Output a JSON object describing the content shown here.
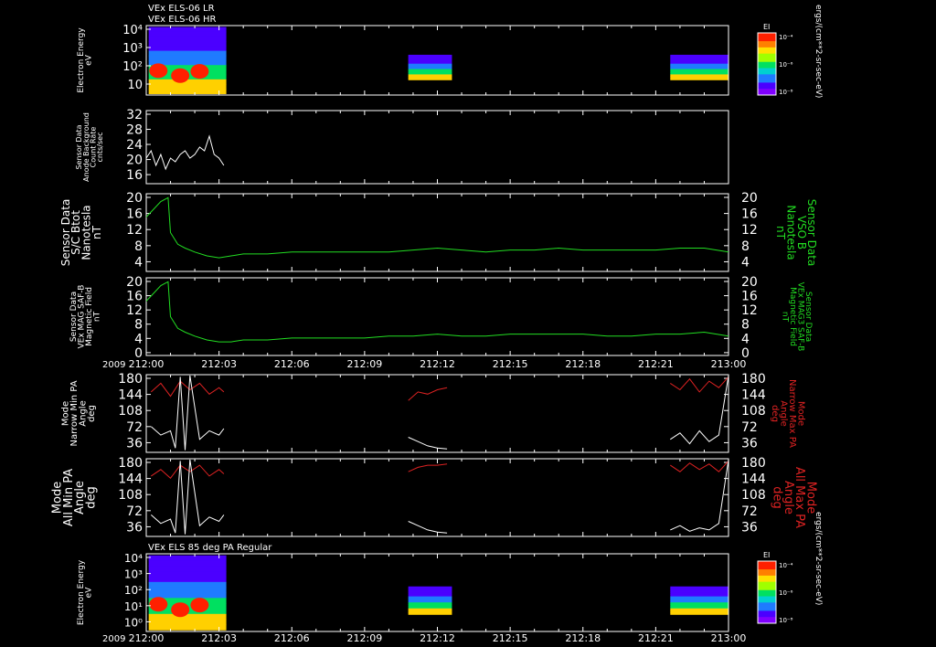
{
  "figure": {
    "top_titles": [
      "VEx ELS-06 LR",
      "VEx ELS-06 HR"
    ],
    "bottom_title": "VEx ELS 85 deg PA Regular",
    "year_label": "2009",
    "time_ticks": [
      "212:00",
      "212:03",
      "212:06",
      "212:09",
      "212:12",
      "212:15",
      "212:18",
      "212:21",
      "213:00"
    ],
    "colorbar_title": "EI",
    "colorbar_unit": "ergs/(cm**2-sr-sec-eV)",
    "colorbar_ticks": [
      "10⁻⁴",
      "10⁻⁶",
      "10⁻⁸"
    ]
  },
  "chart_data": [
    {
      "id": "spec_top",
      "type": "heatmap",
      "ylabel": [
        "Electron Energy",
        "eV"
      ],
      "yscale": "log",
      "ytick_labels": [
        "10⁴",
        "10³",
        "10²",
        "10",
        "1"
      ],
      "data_intervals": [
        "212:00–212:03",
        "212:10:30–212:12:30",
        "212:21:30–213:00"
      ],
      "colors": {
        "low": "#4b00ff",
        "mid": "#00e060",
        "high": "#ff2000"
      }
    },
    {
      "id": "bg_count",
      "type": "line",
      "ylabel": [
        "Sensor Data",
        "Anode Background",
        "Count Rate",
        "cnts/sec"
      ],
      "ylim": [
        12,
        32
      ],
      "ytick_labels": [
        "32",
        "28",
        "24",
        "20",
        "16"
      ],
      "color": "#ffffff",
      "x_minutes": [
        0.0,
        0.2,
        0.4,
        0.6,
        0.8,
        1.0,
        1.2,
        1.4,
        1.6,
        1.8,
        2.0,
        2.2,
        2.4,
        2.6,
        2.8,
        3.0,
        3.2
      ],
      "y": [
        19,
        21,
        17,
        20,
        16,
        19,
        18,
        20,
        21,
        19,
        20,
        22,
        21,
        25,
        20,
        19,
        17
      ]
    },
    {
      "id": "btot",
      "type": "line",
      "ylabel": [
        "Sensor Data",
        "S/C Btot",
        "Nanotesla",
        "nT"
      ],
      "ylabel_right": [
        "Sensor Data",
        "VSO B",
        "Nanotesla",
        "nT"
      ],
      "ylim": [
        0,
        20
      ],
      "ytick_labels": [
        "20",
        "16",
        "12",
        "8",
        "4"
      ],
      "color": "#22dd22",
      "x_minutes": [
        0,
        0.3,
        0.6,
        0.9,
        1.0,
        1.3,
        1.6,
        2.0,
        2.5,
        3.0,
        3.5,
        4.0,
        5.0,
        6.0,
        7.0,
        8.0,
        9.0,
        10.0,
        11.0,
        12.0,
        13.0,
        14.0,
        15.0,
        16.0,
        17.0,
        18.0,
        19.0,
        20.0,
        21.0,
        22.0,
        23.0,
        24.0
      ],
      "y": [
        14,
        16,
        18,
        19,
        10,
        7,
        6,
        5,
        4,
        3.5,
        4,
        4.5,
        4.5,
        5,
        5,
        5,
        5,
        5,
        5.5,
        6,
        5.5,
        5,
        5.5,
        5.5,
        6,
        5.5,
        5.5,
        5.5,
        5.5,
        6,
        6,
        5
      ]
    },
    {
      "id": "mag_field",
      "type": "line",
      "ylabel": [
        "Sensor Data",
        "VEx MAG SAF-B",
        "Magnetic Field",
        "nT"
      ],
      "ylabel_right": [
        "Sensor Data",
        "VEx MAG3 SAF-B",
        "Magnetic Field",
        "nT"
      ],
      "ylim": [
        0,
        20
      ],
      "ytick_labels": [
        "20",
        "16",
        "12",
        "8",
        "4",
        "0"
      ],
      "color": "#22dd22",
      "x_minutes": [
        0,
        0.3,
        0.6,
        0.9,
        1.0,
        1.3,
        1.6,
        2.0,
        2.5,
        3.0,
        3.5,
        4.0,
        5.0,
        6.0,
        7.0,
        8.0,
        9.0,
        10.0,
        11.0,
        12.0,
        13.0,
        14.0,
        15.0,
        16.0,
        17.0,
        18.0,
        19.0,
        20.0,
        21.0,
        22.0,
        23.0,
        24.0
      ],
      "y": [
        14,
        16,
        18,
        19,
        10,
        7,
        6,
        5,
        4,
        3.5,
        3.5,
        4,
        4,
        4.5,
        4.5,
        4.5,
        4.5,
        5,
        5,
        5.5,
        5,
        5,
        5.5,
        5.5,
        5.5,
        5.5,
        5,
        5,
        5.5,
        5.5,
        6,
        5
      ]
    },
    {
      "id": "narrow_pa",
      "type": "line",
      "ylabel": [
        "Mode",
        "Narrow Min PA",
        "Angle",
        "deg"
      ],
      "ylabel_right": [
        "Mode",
        "Narrow Max PA",
        "Angle",
        "deg"
      ],
      "ylim": [
        0,
        180
      ],
      "ytick_labels": [
        "180",
        "144",
        "108",
        "72",
        "36"
      ],
      "series": [
        {
          "color": "#dd2222",
          "segments": [
            {
              "x_minutes": [
                0.2,
                0.6,
                1.0,
                1.4,
                1.8,
                2.2,
                2.6,
                3.0,
                3.2
              ],
              "y": [
                140,
                160,
                130,
                165,
                145,
                160,
                135,
                150,
                140
              ]
            },
            {
              "x_minutes": [
                10.8,
                11.2,
                11.6,
                12.0,
                12.4
              ],
              "y": [
                120,
                140,
                135,
                145,
                150
              ]
            },
            {
              "x_minutes": [
                21.6,
                22.0,
                22.4,
                22.8,
                23.2,
                23.6,
                24.0
              ],
              "y": [
                160,
                145,
                170,
                140,
                165,
                150,
                175
              ]
            }
          ]
        },
        {
          "color": "#ffffff",
          "segments": [
            {
              "x_minutes": [
                0.2,
                0.6,
                1.0,
                1.2,
                1.4,
                1.6,
                1.8,
                2.2,
                2.6,
                3.0,
                3.2
              ],
              "y": [
                60,
                40,
                50,
                10,
                175,
                5,
                178,
                30,
                50,
                40,
                55
              ]
            },
            {
              "x_minutes": [
                10.8,
                11.2,
                11.6,
                12.0,
                12.4
              ],
              "y": [
                35,
                25,
                15,
                10,
                8
              ]
            },
            {
              "x_minutes": [
                21.6,
                22.0,
                22.4,
                22.8,
                23.2,
                23.6,
                24.0
              ],
              "y": [
                30,
                45,
                20,
                50,
                25,
                40,
                178
              ]
            }
          ]
        }
      ]
    },
    {
      "id": "all_pa",
      "type": "line",
      "ylabel": [
        "Mode",
        "All Min PA",
        "Angle",
        "deg"
      ],
      "ylabel_right": [
        "Mode",
        "All Max PA",
        "Angle",
        "deg"
      ],
      "ylim": [
        0,
        180
      ],
      "ytick_labels": [
        "180",
        "144",
        "108",
        "72",
        "36"
      ],
      "series": [
        {
          "color": "#dd2222",
          "segments": [
            {
              "x_minutes": [
                0.2,
                0.6,
                1.0,
                1.4,
                1.8,
                2.2,
                2.6,
                3.0,
                3.2
              ],
              "y": [
                140,
                155,
                135,
                165,
                150,
                165,
                140,
                155,
                145
              ]
            },
            {
              "x_minutes": [
                10.8,
                11.2,
                11.6,
                12.0,
                12.4
              ],
              "y": [
                150,
                160,
                165,
                165,
                168
              ]
            },
            {
              "x_minutes": [
                21.6,
                22.0,
                22.4,
                22.8,
                23.2,
                23.6,
                24.0
              ],
              "y": [
                165,
                150,
                170,
                155,
                168,
                150,
                175
              ]
            }
          ]
        },
        {
          "color": "#ffffff",
          "segments": [
            {
              "x_minutes": [
                0.2,
                0.6,
                1.0,
                1.2,
                1.4,
                1.6,
                1.8,
                2.2,
                2.6,
                3.0,
                3.2
              ],
              "y": [
                50,
                30,
                40,
                8,
                175,
                5,
                178,
                25,
                45,
                35,
                50
              ]
            },
            {
              "x_minutes": [
                10.8,
                11.2,
                11.6,
                12.0,
                12.4
              ],
              "y": [
                35,
                25,
                15,
                10,
                8
              ]
            },
            {
              "x_minutes": [
                21.6,
                22.0,
                22.4,
                22.8,
                23.2,
                23.6,
                24.0
              ],
              "y": [
                15,
                25,
                12,
                20,
                15,
                30,
                178
              ]
            }
          ]
        }
      ]
    },
    {
      "id": "spec_bottom",
      "type": "heatmap",
      "ylabel": [
        "Electron Energy",
        "eV"
      ],
      "yscale": "log",
      "ytick_labels": [
        "10⁴",
        "10³",
        "10²",
        "10¹",
        "10⁰",
        "10⁻¹"
      ],
      "data_intervals": [
        "212:00–212:03",
        "212:10:30–212:12:30",
        "212:21:30–213:00"
      ],
      "colors": {
        "low": "#4b00ff",
        "mid": "#00e060",
        "high": "#ff2000"
      }
    }
  ]
}
